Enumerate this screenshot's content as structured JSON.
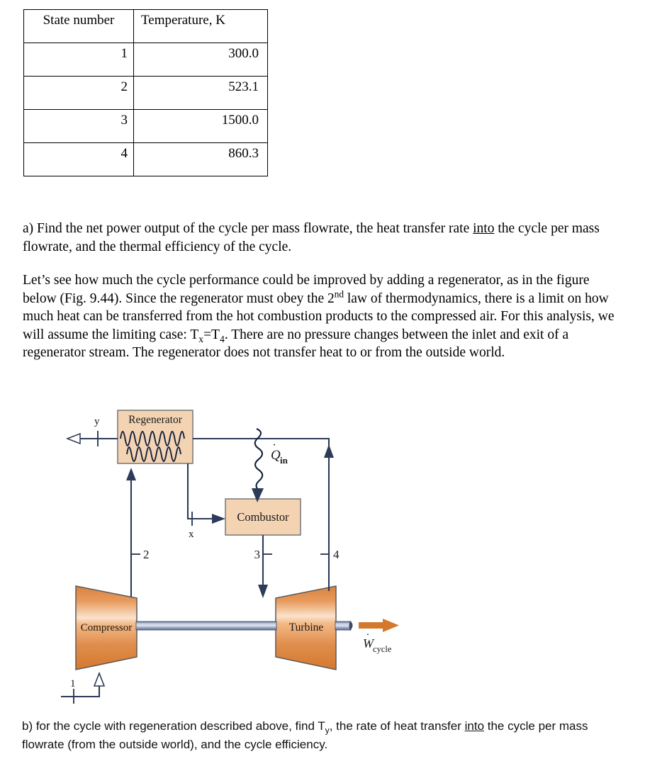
{
  "table": {
    "headers": [
      "State number",
      "Temperature, K"
    ],
    "rows": [
      {
        "state": "1",
        "temperature": "300.0"
      },
      {
        "state": "2",
        "temperature": "523.1"
      },
      {
        "state": "3",
        "temperature": "1500.0"
      },
      {
        "state": "4",
        "temperature": "860.3"
      }
    ]
  },
  "text": {
    "part_a_prefix": "a)  Find the net power output of the cycle per mass flowrate, the heat transfer rate ",
    "part_a_underlined": "into",
    "part_a_suffix": " the cycle per mass flowrate, and the thermal efficiency of the cycle.",
    "intro_seg1": "Let’s see how much the cycle performance could be improved by adding a regenerator, as in the figure below (Fig. 9.44).  Since the regenerator must obey the 2",
    "intro_ord": "nd",
    "intro_seg2": " law of thermodynamics, there is a limit on how much heat can be transferred from the hot combustion products to the compressed air.  For this analysis, we will assume the limiting case:  T",
    "intro_sub1": "x",
    "intro_seg3": "=T",
    "intro_sub2": "4",
    "intro_seg4": ".  There are no pressure changes between the inlet and exit of a regenerator stream.  The regenerator does not transfer heat to or from the outside world.",
    "part_b_prefix": "b) for the cycle with regeneration described above, find T",
    "part_b_sub": "y",
    "part_b_mid": ", the rate of heat transfer ",
    "part_b_underlined": "into",
    "part_b_suffix": " the cycle per mass flowrate (from the outside world), and the cycle efficiency."
  },
  "figure": {
    "regenerator_label": "Regenerator",
    "combustor_label": "Combustor",
    "compressor_label": "Compressor",
    "turbine_label": "Turbine",
    "heat_in_symbol": "Q",
    "heat_in_sub": "in",
    "work_symbol": "W",
    "work_sub": "cycle",
    "state_labels": {
      "one": "1",
      "two": "2",
      "three": "3",
      "four": "4",
      "x": "x",
      "y": "y"
    },
    "colors": {
      "block_fill": "#f4d3b3",
      "block_stroke": "#7d7d7d",
      "line": "#2d3a58",
      "turbo_orange_light": "#f4bb8a",
      "turbo_orange_dark": "#d4763a",
      "shaft_blue": "#aebad6",
      "work_arrow": "#d4782c"
    }
  }
}
